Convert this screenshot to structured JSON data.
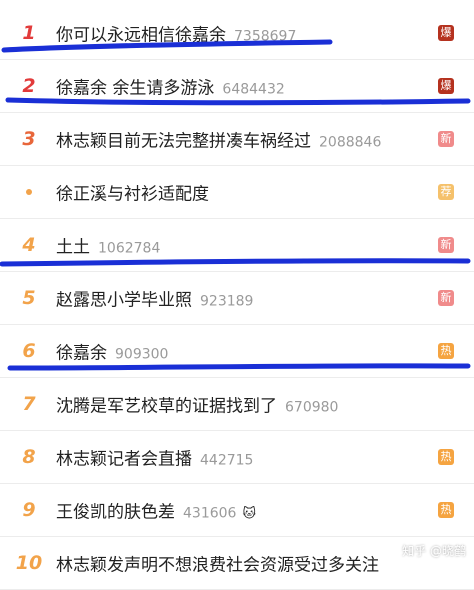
{
  "hot_list": [
    {
      "rank": "1",
      "title": "你可以永远相信徐嘉余",
      "count": "7358697",
      "emoji": "",
      "badge": "爆",
      "rank_color": "#e23b3b",
      "badge_color": "#b5321f"
    },
    {
      "rank": "2",
      "title": "徐嘉余 余生请多游泳",
      "count": "6484432",
      "emoji": "",
      "badge": "爆",
      "rank_color": "#e23b3b",
      "badge_color": "#b5321f"
    },
    {
      "rank": "3",
      "title": "林志颖目前无法完整拼凑车祸经过",
      "count": "2088846",
      "emoji": "",
      "badge": "新",
      "rank_color": "#e8663a",
      "badge_color": "#f08b8b"
    },
    {
      "rank": "",
      "title": "徐正溪与衬衫适配度",
      "count": "",
      "emoji": "",
      "badge": "荐",
      "rank_color": "#f2a34a",
      "badge_color": "#f5c16b"
    },
    {
      "rank": "4",
      "title": "土土",
      "count": "1062784",
      "emoji": "",
      "badge": "新",
      "rank_color": "#f2a34a",
      "badge_color": "#f08b8b"
    },
    {
      "rank": "5",
      "title": "赵露思小学毕业照",
      "count": "923189",
      "emoji": "",
      "badge": "新",
      "rank_color": "#f2a34a",
      "badge_color": "#f08b8b"
    },
    {
      "rank": "6",
      "title": "徐嘉余",
      "count": "909300",
      "emoji": "",
      "badge": "热",
      "rank_color": "#f2a34a",
      "badge_color": "#f5a441"
    },
    {
      "rank": "7",
      "title": "沈腾是军艺校草的证据找到了",
      "count": "670980",
      "emoji": "",
      "badge": "",
      "rank_color": "#f2a34a",
      "badge_color": ""
    },
    {
      "rank": "8",
      "title": "林志颖记者会直播",
      "count": "442715",
      "emoji": "",
      "badge": "热",
      "rank_color": "#f2a34a",
      "badge_color": "#f5a441"
    },
    {
      "rank": "9",
      "title": "王俊凯的肤色差",
      "count": "431606",
      "emoji": "🐱",
      "badge": "热",
      "rank_color": "#f2a34a",
      "badge_color": "#f5a441"
    },
    {
      "rank": "10",
      "title": "林志颖发声明不想浪费社会资源受过多关注",
      "count": "",
      "emoji": "",
      "badge": "",
      "rank_color": "#f2a34a",
      "badge_color": ""
    }
  ],
  "watermark": "知乎 @晓鹤",
  "colors": {
    "annotation_ink": "#1a2fd6"
  }
}
